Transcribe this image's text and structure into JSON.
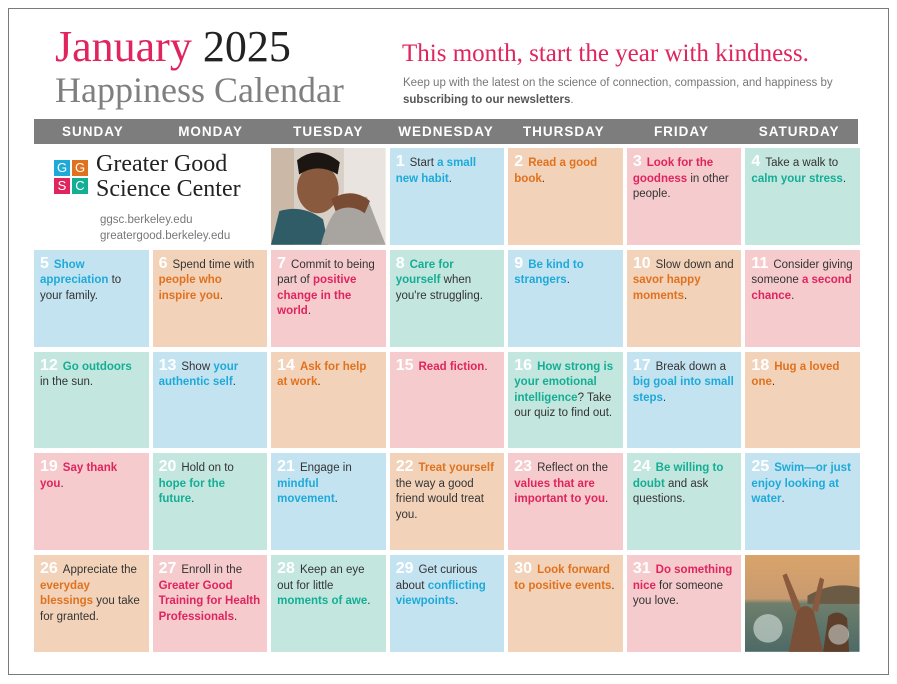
{
  "header": {
    "month": "January",
    "year": "2025",
    "subtitle": "Happiness Calendar",
    "tagline": "This month, start the year with kindness.",
    "blurb_text": "Keep up with the latest on the science of connection, compassion, and happiness by ",
    "blurb_link": "subscribing to our newsletters",
    "blurb_end": "."
  },
  "weekdays": [
    "SUNDAY",
    "MONDAY",
    "TUESDAY",
    "WEDNESDAY",
    "THURSDAY",
    "FRIDAY",
    "SATURDAY"
  ],
  "logo": {
    "letters": [
      "G",
      "G",
      "S",
      "C"
    ],
    "colors": [
      "#1eaad8",
      "#e0721f",
      "#e0245e",
      "#14ae94"
    ],
    "name_line1": "Greater Good",
    "name_line2": "Science Center",
    "link1": "ggsc.berkeley.edu",
    "link2": "greatergood.berkeley.edu"
  },
  "images": {
    "top": "photo-two-people-hugging",
    "bottom": "photo-people-splashing-in-water"
  },
  "days": [
    {
      "n": "1",
      "bg": "blue",
      "parts": [
        [
          "Start ",
          ""
        ],
        [
          "a small new habit",
          "blue"
        ],
        [
          ".",
          ""
        ]
      ]
    },
    {
      "n": "2",
      "bg": "peach",
      "parts": [
        [
          "Read a good book",
          "orange"
        ],
        [
          ".",
          ""
        ]
      ]
    },
    {
      "n": "3",
      "bg": "pink",
      "parts": [
        [
          "Look for the goodness",
          "pink"
        ],
        [
          " in other people.",
          ""
        ]
      ]
    },
    {
      "n": "4",
      "bg": "mint",
      "parts": [
        [
          "Take a walk to ",
          ""
        ],
        [
          "calm your stress",
          "teal"
        ],
        [
          ".",
          ""
        ]
      ]
    },
    {
      "n": "5",
      "bg": "blue",
      "parts": [
        [
          "Show appreciation",
          "blue"
        ],
        [
          " to your family.",
          ""
        ]
      ]
    },
    {
      "n": "6",
      "bg": "peach",
      "parts": [
        [
          "Spend time with ",
          ""
        ],
        [
          "people who inspire you",
          "orange"
        ],
        [
          ".",
          ""
        ]
      ]
    },
    {
      "n": "7",
      "bg": "pink",
      "parts": [
        [
          "Commit to being part of ",
          ""
        ],
        [
          "positive change in the world",
          "pink"
        ],
        [
          ".",
          ""
        ]
      ]
    },
    {
      "n": "8",
      "bg": "mint",
      "parts": [
        [
          "Care for yourself",
          "teal"
        ],
        [
          " when you're struggling.",
          ""
        ]
      ]
    },
    {
      "n": "9",
      "bg": "blue",
      "parts": [
        [
          "Be kind to strangers",
          "blue"
        ],
        [
          ".",
          ""
        ]
      ]
    },
    {
      "n": "10",
      "bg": "peach",
      "parts": [
        [
          "Slow down and ",
          ""
        ],
        [
          "savor happy moments",
          "orange"
        ],
        [
          ".",
          ""
        ]
      ]
    },
    {
      "n": "11",
      "bg": "pink",
      "parts": [
        [
          "Consider giving someone ",
          ""
        ],
        [
          "a second chance",
          "pink"
        ],
        [
          ".",
          ""
        ]
      ]
    },
    {
      "n": "12",
      "bg": "mint",
      "parts": [
        [
          "Go outdoors",
          "teal"
        ],
        [
          " in the sun.",
          ""
        ]
      ]
    },
    {
      "n": "13",
      "bg": "blue",
      "parts": [
        [
          "Show ",
          ""
        ],
        [
          "your authentic self",
          "blue"
        ],
        [
          ".",
          ""
        ]
      ]
    },
    {
      "n": "14",
      "bg": "peach",
      "parts": [
        [
          "Ask for help at work",
          "orange"
        ],
        [
          ".",
          ""
        ]
      ]
    },
    {
      "n": "15",
      "bg": "pink",
      "parts": [
        [
          "Read fiction",
          "pink"
        ],
        [
          ".",
          ""
        ]
      ]
    },
    {
      "n": "16",
      "bg": "mint",
      "parts": [
        [
          "How strong is your emotional intelligence",
          "teal"
        ],
        [
          "? Take our quiz to find out.",
          ""
        ]
      ]
    },
    {
      "n": "17",
      "bg": "blue",
      "parts": [
        [
          "Break down a ",
          ""
        ],
        [
          "big goal into small steps",
          "blue"
        ],
        [
          ".",
          ""
        ]
      ]
    },
    {
      "n": "18",
      "bg": "peach",
      "parts": [
        [
          "Hug a loved one",
          "orange"
        ],
        [
          ".",
          ""
        ]
      ]
    },
    {
      "n": "19",
      "bg": "pink",
      "parts": [
        [
          "Say thank you",
          "pink"
        ],
        [
          ".",
          ""
        ]
      ]
    },
    {
      "n": "20",
      "bg": "mint",
      "parts": [
        [
          "Hold on to ",
          ""
        ],
        [
          "hope for the future",
          "teal"
        ],
        [
          ".",
          ""
        ]
      ]
    },
    {
      "n": "21",
      "bg": "blue",
      "parts": [
        [
          "Engage in ",
          ""
        ],
        [
          "mindful movement",
          "blue"
        ],
        [
          ".",
          ""
        ]
      ]
    },
    {
      "n": "22",
      "bg": "peach",
      "parts": [
        [
          "Treat yourself",
          "orange"
        ],
        [
          " the way a good friend would treat you.",
          ""
        ]
      ]
    },
    {
      "n": "23",
      "bg": "pink",
      "parts": [
        [
          "Reflect on the ",
          ""
        ],
        [
          "values that are important to you",
          "pink"
        ],
        [
          ".",
          ""
        ]
      ]
    },
    {
      "n": "24",
      "bg": "mint",
      "parts": [
        [
          "Be willing to doubt",
          "teal"
        ],
        [
          " and ask questions.",
          ""
        ]
      ]
    },
    {
      "n": "25",
      "bg": "blue",
      "parts": [
        [
          "Swim—or just enjoy looking at water",
          "blue"
        ],
        [
          ".",
          ""
        ]
      ]
    },
    {
      "n": "26",
      "bg": "peach",
      "parts": [
        [
          "Appreciate the ",
          ""
        ],
        [
          "everyday blessings",
          "orange"
        ],
        [
          " you take for granted.",
          ""
        ]
      ]
    },
    {
      "n": "27",
      "bg": "pink",
      "parts": [
        [
          "Enroll in the ",
          ""
        ],
        [
          "Greater Good Training for Health Professionals",
          "pink"
        ],
        [
          ".",
          ""
        ]
      ]
    },
    {
      "n": "28",
      "bg": "mint",
      "parts": [
        [
          "Keep an eye out for little ",
          ""
        ],
        [
          "moments of awe",
          "teal"
        ],
        [
          ".",
          ""
        ]
      ]
    },
    {
      "n": "29",
      "bg": "blue",
      "parts": [
        [
          "Get curious about ",
          ""
        ],
        [
          "conflicting viewpoints",
          "blue"
        ],
        [
          ".",
          ""
        ]
      ]
    },
    {
      "n": "30",
      "bg": "peach",
      "parts": [
        [
          "Look forward to positive events",
          "orange"
        ],
        [
          ".",
          ""
        ]
      ]
    },
    {
      "n": "31",
      "bg": "pink",
      "parts": [
        [
          "Do something nice",
          "pink"
        ],
        [
          " for someone you love.",
          ""
        ]
      ]
    }
  ]
}
